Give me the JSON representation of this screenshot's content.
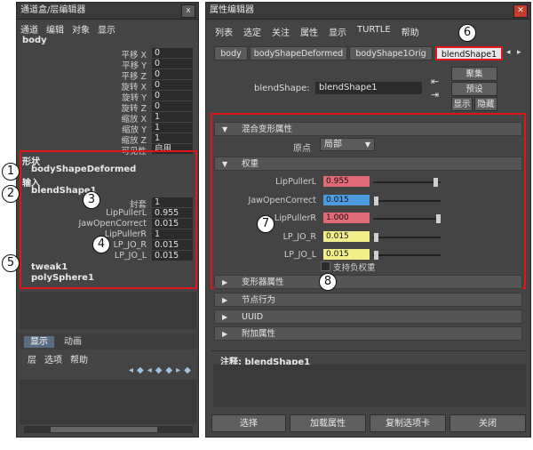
{
  "left_panel": {
    "title": "通道盒/层编辑器",
    "close": "x",
    "menu": [
      "通道",
      "编辑",
      "对象",
      "显示"
    ],
    "object_name": "body",
    "channels": [
      {
        "name": "平移 X",
        "value": "0"
      },
      {
        "name": "平移 Y",
        "value": "0"
      },
      {
        "name": "平移 Z",
        "value": "0"
      },
      {
        "name": "旋转 X",
        "value": "0"
      },
      {
        "name": "旋转 Y",
        "value": "0"
      },
      {
        "name": "旋转 Z",
        "value": "0"
      },
      {
        "name": "缩放 X",
        "value": "1"
      },
      {
        "name": "缩放 Y",
        "value": "1"
      },
      {
        "name": "缩放 Z",
        "value": "1"
      },
      {
        "name": "可见性",
        "value": "启用"
      }
    ],
    "shape_header": "形状",
    "shape_name": "bodyShapeDeformed",
    "input_header": "输入",
    "blendshape_name": "blendShape1",
    "blend_attrs": [
      {
        "name": "封套",
        "value": "1"
      },
      {
        "name": "LipPullerL",
        "value": "0.955"
      },
      {
        "name": "JawOpenCorrect",
        "value": "0.015"
      },
      {
        "name": "LipPullerR",
        "value": "1"
      },
      {
        "name": "LP_JO_R",
        "value": "0.015"
      },
      {
        "name": "LP_JO_L",
        "value": "0.015"
      }
    ],
    "other_inputs": [
      "tweak1",
      "polySphere1"
    ],
    "layer_tabs": [
      "显示",
      "动画"
    ],
    "layer_menu": [
      "层",
      "选项",
      "帮助"
    ]
  },
  "right_panel": {
    "title": "属性编辑器",
    "menu": [
      "列表",
      "选定",
      "关注",
      "属性",
      "显示",
      "TURTLE",
      "帮助"
    ],
    "tabs": [
      "body",
      "bodyShapeDeformed",
      "bodyShape1Orig",
      "blendShape1"
    ],
    "active_tab": "blendShape1",
    "node_label": "blendShape:",
    "node_value": "blendShape1",
    "side_buttons": [
      "聚集",
      "预设",
      "显示",
      "隐藏"
    ],
    "sections": {
      "blend_attrs": "混合变形属性",
      "origin_label": "原点",
      "origin_value": "局部",
      "weights": "权重",
      "deformer_attrs": "变形器属性",
      "node_behavior": "节点行为",
      "uuid": "UUID",
      "extra_attrs": "附加属性"
    },
    "weights": [
      {
        "name": "LipPullerL",
        "value": "0.955",
        "fraction": 0.955,
        "color": "#e06b76"
      },
      {
        "name": "JawOpenCorrect",
        "value": "0.015",
        "fraction": 0.015,
        "color": "#4c9be0"
      },
      {
        "name": "LipPullerR",
        "value": "1.000",
        "fraction": 1.0,
        "color": "#e06b76"
      },
      {
        "name": "LP_JO_R",
        "value": "0.015",
        "fraction": 0.015,
        "color": "#f2ee8a"
      },
      {
        "name": "LP_JO_L",
        "value": "0.015",
        "fraction": 0.015,
        "color": "#f2ee8a"
      }
    ],
    "support_negative": "支持负权重",
    "notes_label": "注释:  blendShape1",
    "bottom_buttons": [
      "选择",
      "加载属性",
      "复制选项卡",
      "关闭"
    ]
  },
  "markers": [
    "1",
    "2",
    "3",
    "4",
    "5",
    "6",
    "7",
    "8"
  ],
  "colors": {
    "panel": "#444444",
    "highlight": "#e0151a"
  }
}
